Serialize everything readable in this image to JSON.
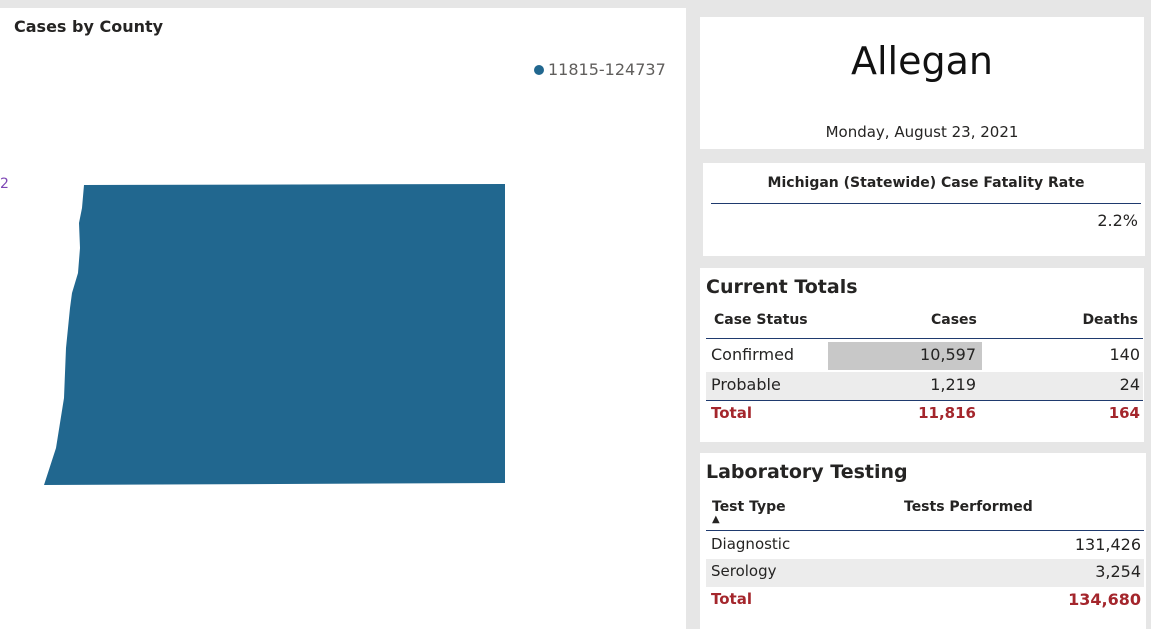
{
  "map": {
    "title": "Cases by County",
    "legend_label": "11815-124737",
    "fill_color": "#21678f",
    "edge_mark": "2"
  },
  "header": {
    "county": "Allegan",
    "date": "Monday, August 23, 2021"
  },
  "fatality": {
    "label": "Michigan (Statewide) Case Fatality Rate",
    "value": "2.2%"
  },
  "totals": {
    "title": "Current Totals",
    "columns": [
      "Case Status",
      "Cases",
      "Deaths"
    ],
    "rows": [
      {
        "status": "Confirmed",
        "cases": "10,597",
        "deaths": "140"
      },
      {
        "status": "Probable",
        "cases": "1,219",
        "deaths": "24"
      }
    ],
    "total": {
      "status": "Total",
      "cases": "11,816",
      "deaths": "164"
    }
  },
  "testing": {
    "title": "Laboratory Testing",
    "columns": [
      "Test Type",
      "Tests Performed"
    ],
    "sort_indicator": "▲",
    "rows": [
      {
        "type": "Diagnostic",
        "performed": "131,426"
      },
      {
        "type": "Serology",
        "performed": "3,254"
      }
    ],
    "total": {
      "type": "Total",
      "performed": "134,680"
    }
  },
  "colors": {
    "total_red": "#a4262c",
    "row_alt": "#ececec",
    "cell_highlight": "#c8c8c8",
    "divider": "#1f3a6e"
  }
}
